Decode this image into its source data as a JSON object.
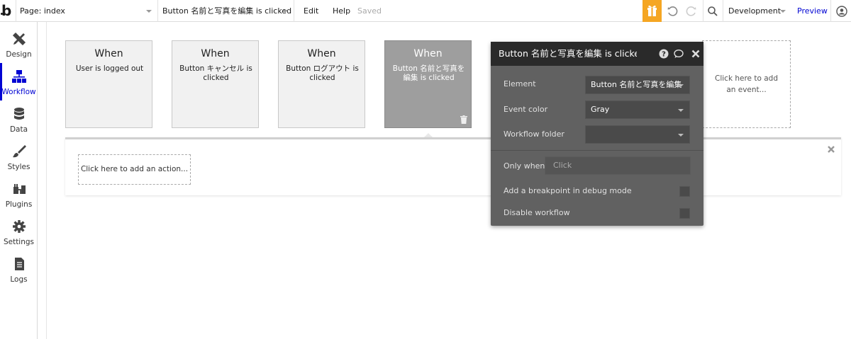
{
  "topbar": {
    "page_label": "Page: index",
    "workflow_selector": "Button 名前と写真を編集 is clicked",
    "menu_edit": "Edit",
    "menu_help": "Help",
    "save_status": "Saved",
    "environment": "Development",
    "preview": "Preview"
  },
  "sidebar": {
    "items": [
      {
        "label": "Design",
        "icon": "design-icon"
      },
      {
        "label": "Workflow",
        "icon": "workflow-icon"
      },
      {
        "label": "Data",
        "icon": "database-icon"
      },
      {
        "label": "Styles",
        "icon": "brush-icon"
      },
      {
        "label": "Plugins",
        "icon": "plug-icon"
      },
      {
        "label": "Settings",
        "icon": "gear-icon"
      },
      {
        "label": "Logs",
        "icon": "document-icon"
      }
    ]
  },
  "events": [
    {
      "when": "When",
      "desc": "User is logged out"
    },
    {
      "when": "When",
      "desc": "Button キャンセル is clicked"
    },
    {
      "when": "When",
      "desc": "Button ログアウト is clicked"
    },
    {
      "when": "When",
      "desc": "Button 名前と写真を編集 is clicked"
    }
  ],
  "add_event_label": "Click here to add an event...",
  "add_action_label": "Click here to add an action...",
  "property_editor": {
    "title": "Button 名前と写真を編集 is clicked",
    "element_label": "Element",
    "element_value": "Button 名前と写真を編集",
    "event_color_label": "Event color",
    "event_color_value": "Gray",
    "workflow_folder_label": "Workflow folder",
    "workflow_folder_value": "",
    "only_when_label": "Only when",
    "only_when_placeholder": "Click",
    "breakpoint_label": "Add a breakpoint in debug mode",
    "disable_label": "Disable workflow"
  },
  "colors": {
    "accent": "#0205d3",
    "gift": "#f5a623",
    "selected_event": "#9e9e9e",
    "editor_bg": "#616161",
    "editor_header": "#2a2a2a"
  }
}
